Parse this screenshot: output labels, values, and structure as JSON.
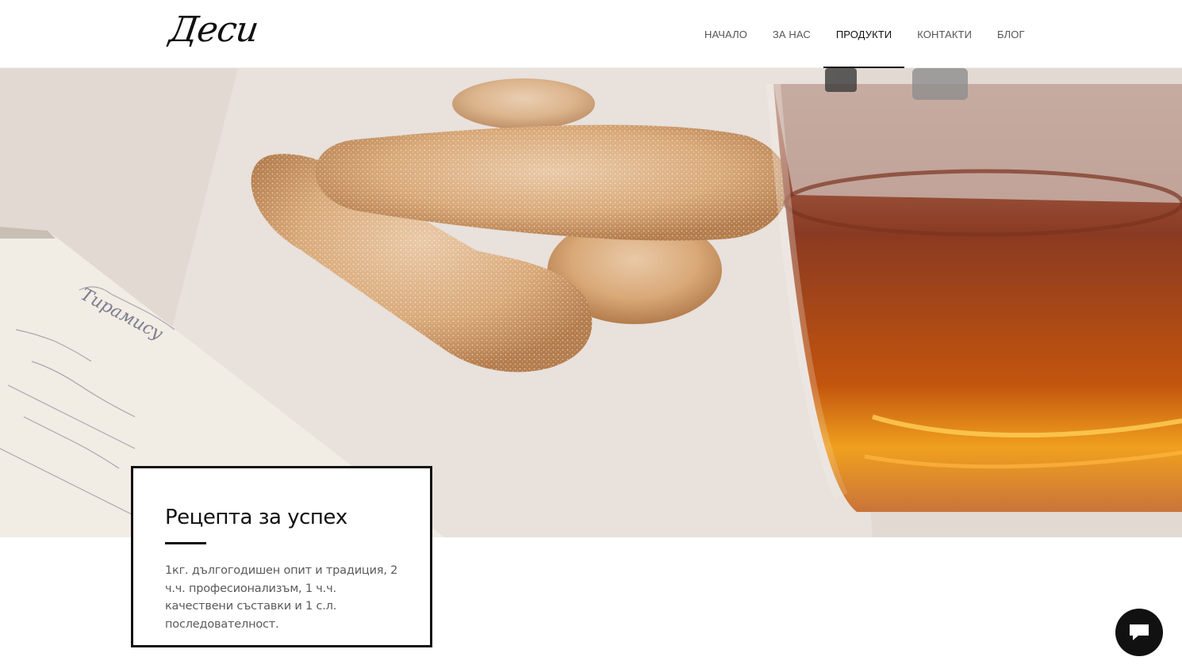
{
  "brand": {
    "logo_text": "Деси"
  },
  "nav": {
    "items": [
      {
        "label": "НАЧАЛО",
        "active": false
      },
      {
        "label": "ЗА НАС",
        "active": false
      },
      {
        "label": "ПРОДУКТИ",
        "active": true
      },
      {
        "label": "КОНТАКТИ",
        "active": false
      },
      {
        "label": "БЛОГ",
        "active": false
      }
    ]
  },
  "hero": {
    "image": "ladyfinger-biscuits-and-tea-photo",
    "notebook_script": "Тирамису"
  },
  "card": {
    "title": "Рецепта за успех",
    "text": "1кг. дългогодишен опит и традиция, 2 ч.ч. професионализъм, 1 ч.ч. качествени съставки и 1 с.л. последователност."
  },
  "chat": {
    "icon": "chat-bubble-icon"
  },
  "colors": {
    "accent": "#111111",
    "text_muted": "#5a5a5a",
    "background": "#ffffff"
  }
}
